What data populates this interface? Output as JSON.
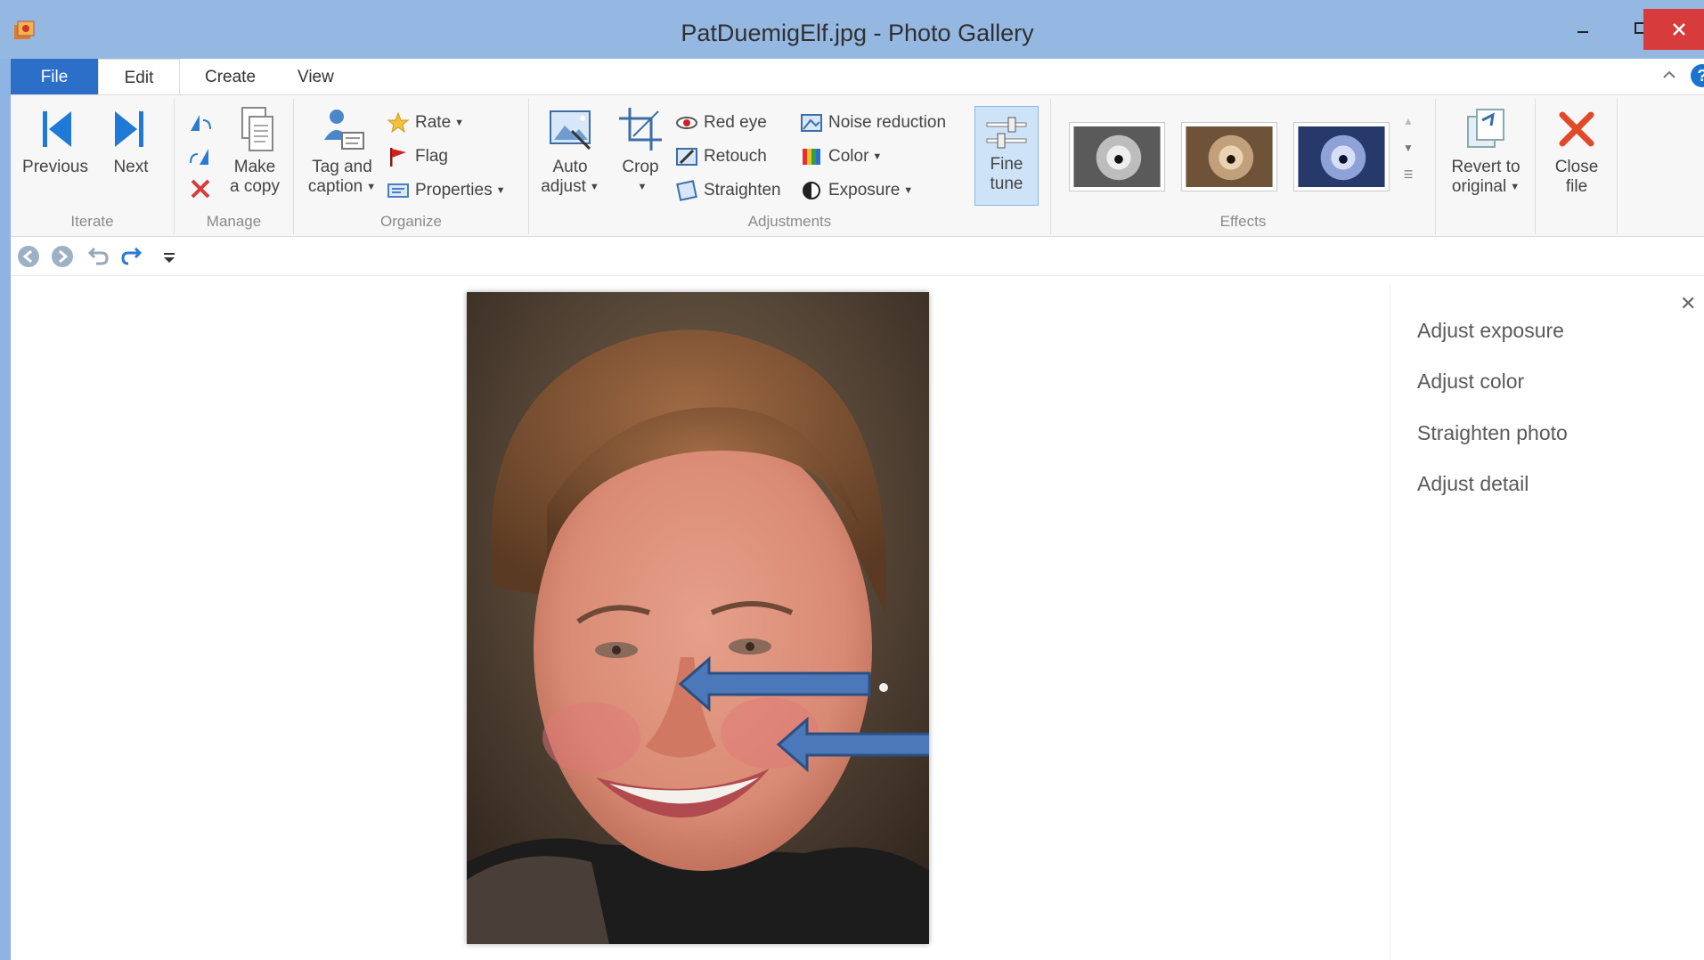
{
  "window": {
    "title": "PatDuemigElf.jpg - Photo Gallery"
  },
  "tabs": {
    "file": "File",
    "edit": "Edit",
    "create": "Create",
    "view": "View"
  },
  "ribbon": {
    "iterate": {
      "label": "Iterate",
      "previous": "Previous",
      "next": "Next"
    },
    "manage": {
      "label": "Manage",
      "make_copy_line1": "Make",
      "make_copy_line2": "a copy"
    },
    "organize": {
      "label": "Organize",
      "tag_line1": "Tag and",
      "tag_line2": "caption",
      "rate": "Rate",
      "flag": "Flag",
      "properties": "Properties"
    },
    "adjustments": {
      "label": "Adjustments",
      "auto_line1": "Auto",
      "auto_line2": "adjust",
      "crop": "Crop",
      "red_eye": "Red eye",
      "retouch": "Retouch",
      "straighten": "Straighten",
      "noise_reduction": "Noise reduction",
      "color": "Color",
      "exposure": "Exposure",
      "fine_line1": "Fine",
      "fine_line2": "tune"
    },
    "effects": {
      "label": "Effects"
    },
    "revert": {
      "line1": "Revert to",
      "line2": "original"
    },
    "close": {
      "line1": "Close",
      "line2": "file"
    }
  },
  "side_pane": {
    "items": [
      "Adjust exposure",
      "Adjust color",
      "Straighten photo",
      "Adjust detail"
    ]
  },
  "colors": {
    "accent": "#2b6fc9",
    "titlebar": "#95b8e3",
    "close": "#d83b3b",
    "arrow": "#4a78b8"
  }
}
